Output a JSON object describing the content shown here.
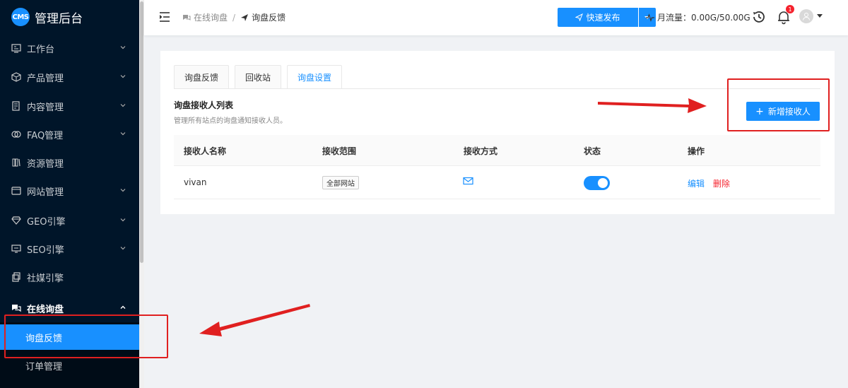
{
  "sidebar": {
    "logo_badge": "CMS",
    "title": "管理后台",
    "items": [
      {
        "label": "工作台",
        "icon": "dashboard-icon"
      },
      {
        "label": "产品管理",
        "icon": "cube-icon"
      },
      {
        "label": "内容管理",
        "icon": "document-icon"
      },
      {
        "label": "FAQ管理",
        "icon": "faq-icon"
      },
      {
        "label": "资源管理",
        "icon": "resource-icon"
      },
      {
        "label": "网站管理",
        "icon": "website-icon"
      },
      {
        "label": "GEO引擎",
        "icon": "diamond-icon"
      },
      {
        "label": "SEO引擎",
        "icon": "monitor-icon"
      },
      {
        "label": "社媒引擎",
        "icon": "copy-icon"
      },
      {
        "label": "在线询盘",
        "icon": "chat-icon"
      }
    ],
    "sub_items": [
      {
        "label": "询盘反馈"
      },
      {
        "label": "订单管理"
      }
    ]
  },
  "header": {
    "breadcrumb": [
      {
        "label": "在线询盘",
        "icon": "chat-icon"
      },
      {
        "label": "询盘反馈",
        "icon": "send-icon"
      }
    ],
    "breadcrumb_sep": "/",
    "publish_label": "快速发布",
    "traffic_label": "月流量：0.00G/50.00G",
    "notification_count": "1"
  },
  "tabs": [
    {
      "label": "询盘反馈"
    },
    {
      "label": "回收站"
    },
    {
      "label": "询盘设置"
    }
  ],
  "section": {
    "title": "询盘接收人列表",
    "description": "管理所有站点的询盘通知接收人员。",
    "add_button": "新增接收人",
    "add_button_icon": "+"
  },
  "table": {
    "columns": [
      "接收人名称",
      "接收范围",
      "接收方式",
      "状态",
      "操作"
    ],
    "rows": [
      {
        "name": "vivan",
        "scope": "全部网站",
        "method": "mail-icon",
        "enabled": true,
        "edit": "编辑",
        "delete": "删除"
      }
    ]
  },
  "colors": {
    "primary": "#1890ff",
    "sidebar_bg": "#001529",
    "danger": "#f5222d",
    "annotation": "#e02020"
  }
}
